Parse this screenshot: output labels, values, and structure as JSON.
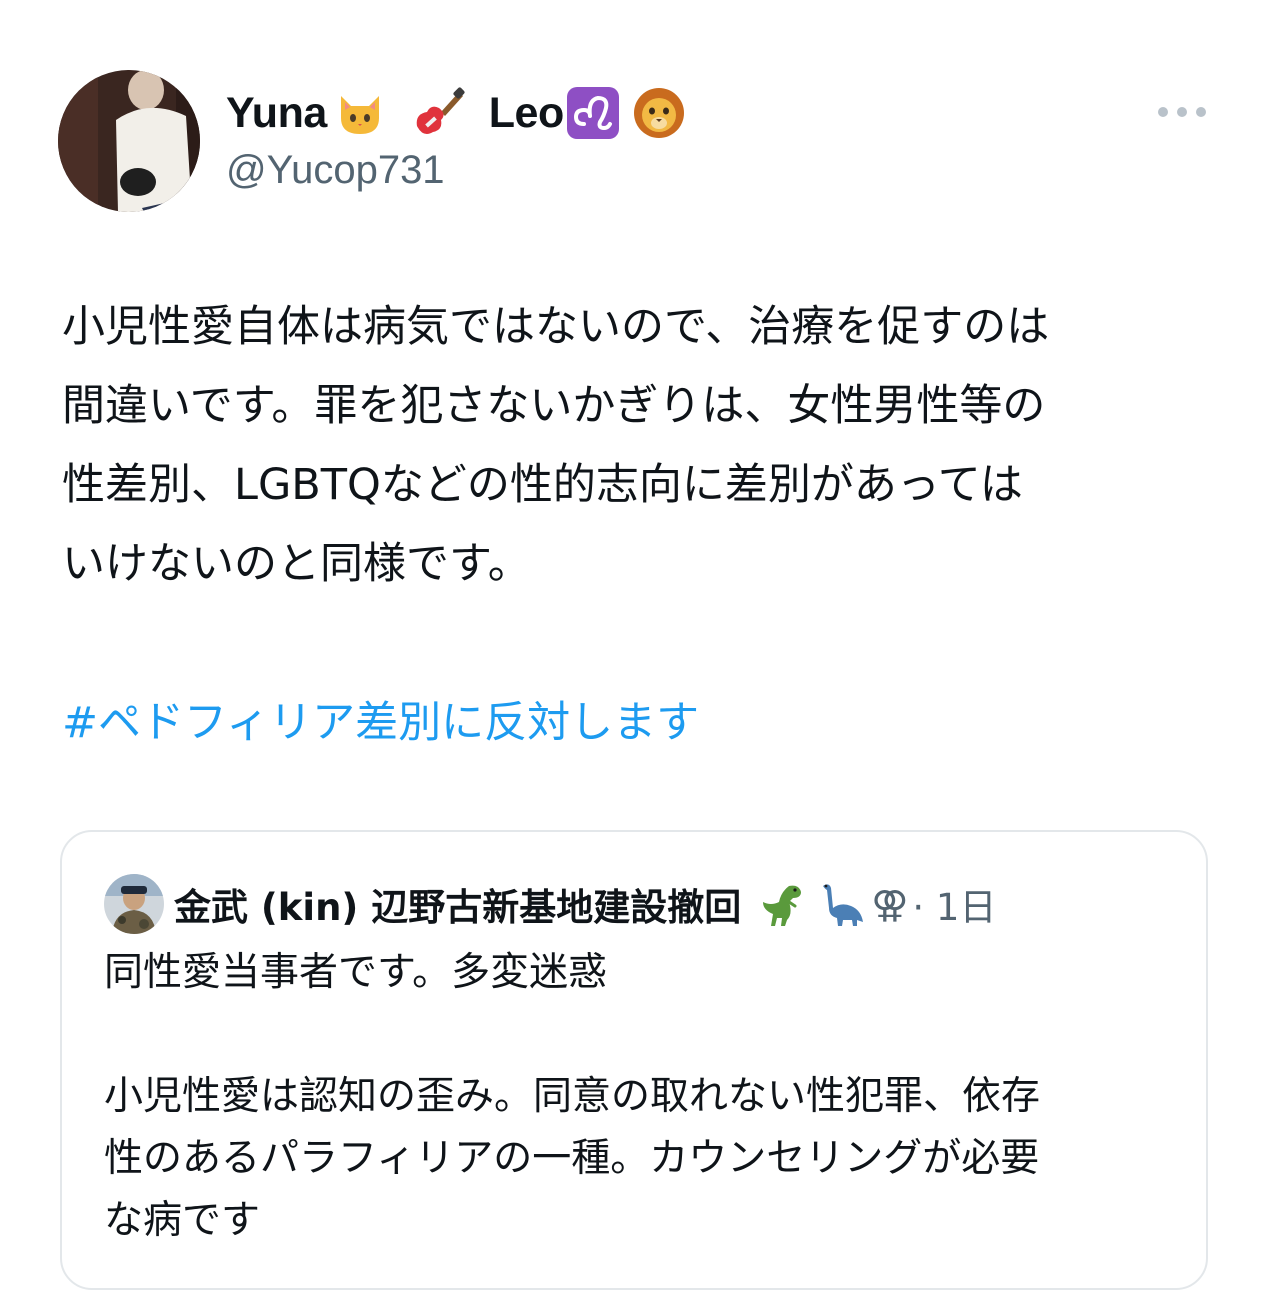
{
  "author": {
    "name": "Yuna",
    "name_suffix": "Leo",
    "handle": "@Yucop731",
    "name_icons": [
      "cat-emoji",
      "guitar-emoji",
      "leo-zodiac-emoji",
      "lion-emoji"
    ]
  },
  "tweet": {
    "lines": [
      "小児性愛自体は病気ではないので、治療を促すのは",
      "間違いです。罪を犯さないかぎりは、女性男性等の",
      "性差別、LGBTQなどの性的志向に差別があっては",
      "いけないのと同様です。"
    ],
    "hashtag": "#ペドフィリア差別に反対します"
  },
  "quoted": {
    "name": "金武 (kin) 辺野古新基地建設撤回",
    "name_icons": [
      "t-rex-emoji",
      "sauropod-emoji"
    ],
    "gender_symbol": "⚢",
    "time": "· 1日",
    "lines": [
      "同性愛当事者です。多変迷惑",
      "",
      "小児性愛は認知の歪み。同意の取れない性犯罪、依存",
      "性のあるパラフィリアの一種。カウンセリングが必要",
      "な病です"
    ]
  },
  "colors": {
    "text": "#0f1419",
    "secondary": "#536471",
    "link": "#1d9bf0",
    "border": "#e3e7ea"
  }
}
